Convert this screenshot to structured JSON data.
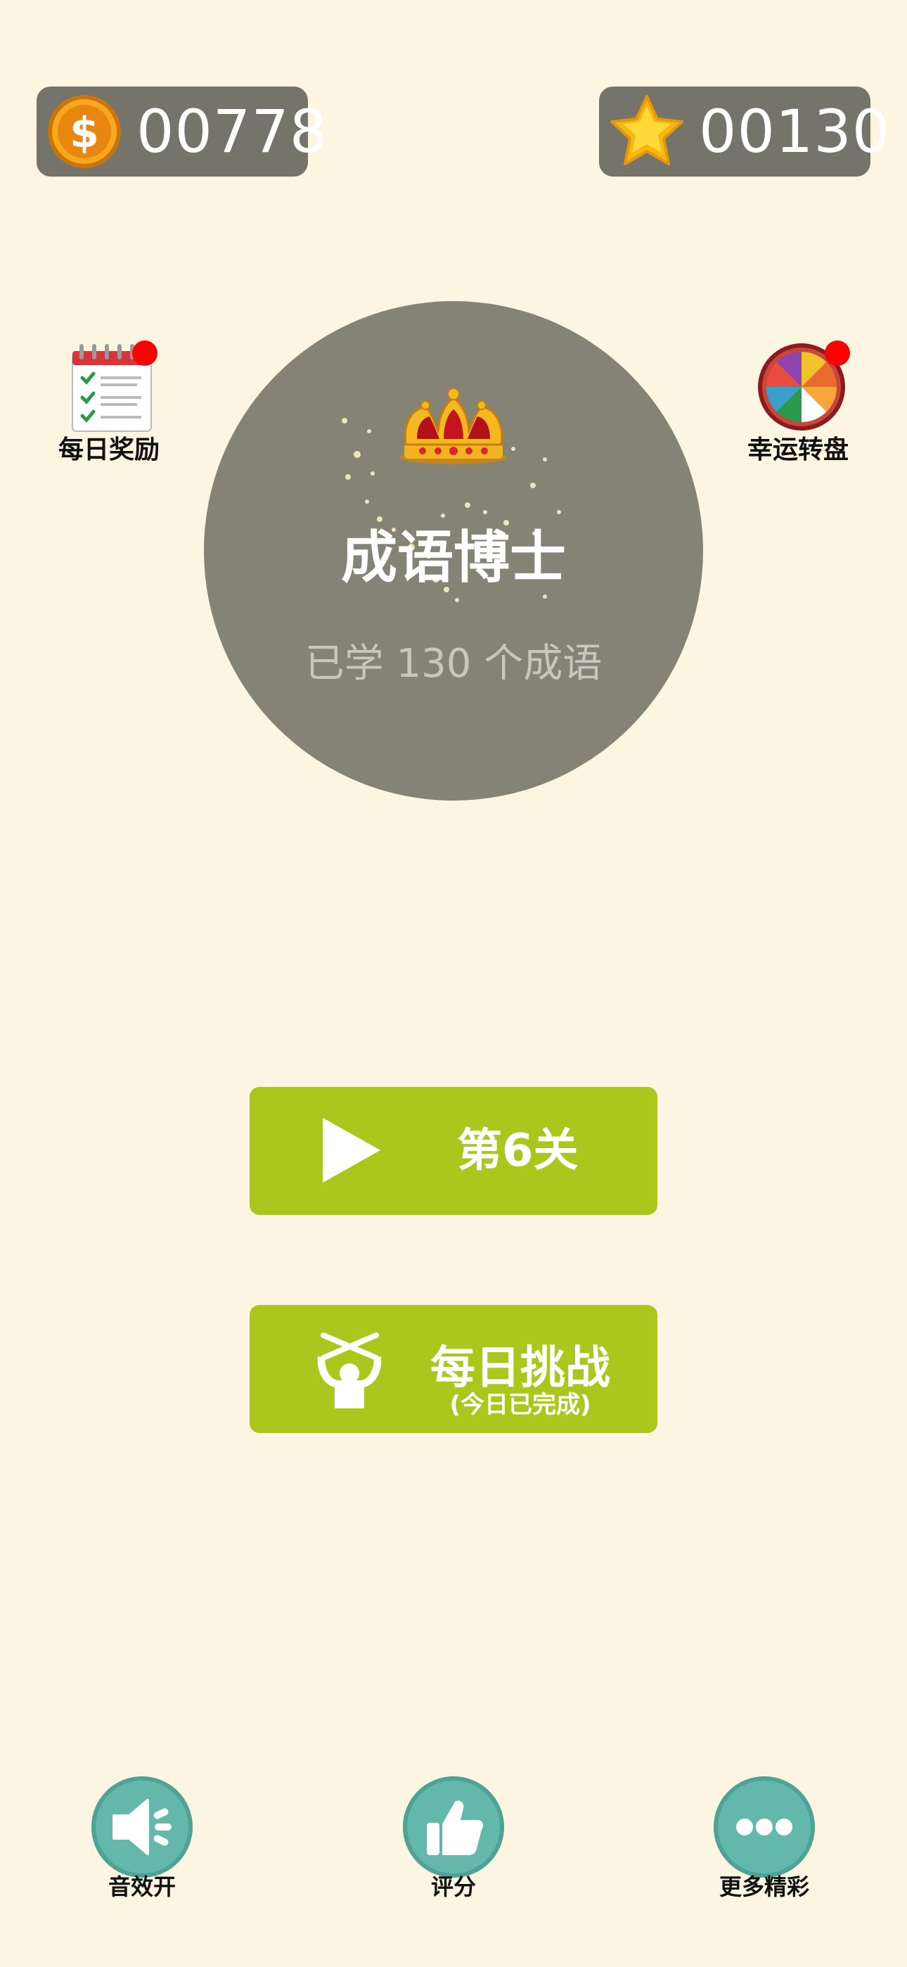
{
  "header": {
    "coins": {
      "value": "00778",
      "icon": "coin-icon"
    },
    "stars": {
      "value": "00130",
      "icon": "star-icon"
    }
  },
  "side": {
    "daily_reward": {
      "label": "每日奖励",
      "icon": "calendar-checklist-icon",
      "has_badge": true
    },
    "lucky_wheel": {
      "label": "幸运转盘",
      "icon": "wheel-icon",
      "has_badge": true
    }
  },
  "profile": {
    "title": "成语博士",
    "subtitle": "已学 130 个成语",
    "icon": "crown-icon"
  },
  "buttons": {
    "play": {
      "label": "第6关",
      "icon": "play-icon"
    },
    "challenge": {
      "label": "每日挑战",
      "sub": "(今日已完成)",
      "icon": "challenge-icon"
    }
  },
  "bottom": {
    "sound": {
      "label": "音效开",
      "icon": "speaker-icon"
    },
    "rate": {
      "label": "评分",
      "icon": "thumbs-up-icon"
    },
    "more": {
      "label": "更多精彩",
      "icon": "more-dots-icon"
    }
  },
  "colors": {
    "background": "#fbf5e1",
    "counter_bg": "#75746a",
    "circle_bg": "#858276",
    "button_green": "#abc71d",
    "bottom_teal": "#63b7ab",
    "badge_red": "#ff0000"
  }
}
